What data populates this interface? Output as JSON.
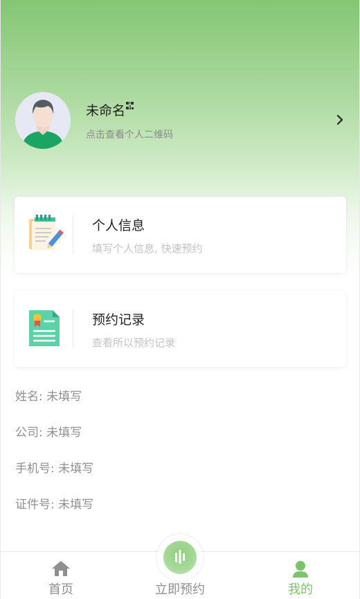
{
  "profile": {
    "name": "未命名",
    "subtitle": "点击查看个人二维码"
  },
  "cards": [
    {
      "title": "个人信息",
      "subtitle": "填写个人信息, 快速预约",
      "icon": "notepad-pencil-icon"
    },
    {
      "title": "预约记录",
      "subtitle": "查看所以预约记录",
      "icon": "certificate-document-icon"
    }
  ],
  "info": {
    "name": "姓名: 未填写",
    "company": "公司: 未填写",
    "phone": "手机号: 未填写",
    "id_number": "证件号: 未填写"
  },
  "tabbar": {
    "home": "首页",
    "book": "立即预约",
    "mine": "我的",
    "active_tab": "mine",
    "active_color": "#7cc46b",
    "inactive_color": "#8f8f8f"
  },
  "colors": {
    "header_green": "#84c674",
    "avatar_shirt": "#1aa562"
  }
}
